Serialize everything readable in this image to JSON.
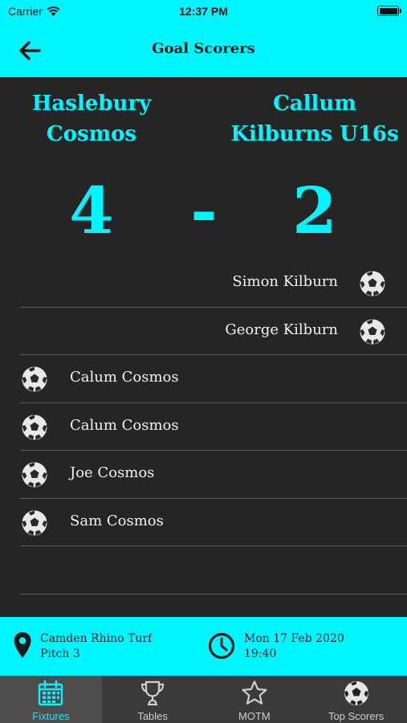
{
  "status_bar": {
    "carrier": "Carrier",
    "time": "12:37 PM"
  },
  "nav": {
    "title": "Goal Scorers"
  },
  "match": {
    "home_team": "Haslebury Cosmos",
    "away_team": "Callum Kilburns U16s",
    "home_score": "4",
    "separator": "-",
    "away_score": "2"
  },
  "scorers": [
    {
      "name": "Simon Kilburn",
      "side": "away"
    },
    {
      "name": "George Kilburn",
      "side": "away"
    },
    {
      "name": "Calum Cosmos",
      "side": "home"
    },
    {
      "name": "Calum Cosmos",
      "side": "home"
    },
    {
      "name": "Joe Cosmos",
      "side": "home"
    },
    {
      "name": "Sam Cosmos",
      "side": "home"
    }
  ],
  "info": {
    "venue": "Camden Rhino Turf",
    "pitch": "Pitch 3",
    "date": "Mon 17 Feb 2020",
    "time": "19:40"
  },
  "tabs": [
    {
      "label": "Fixtures",
      "icon": "calendar-icon",
      "active": true
    },
    {
      "label": "Tables",
      "icon": "trophy-icon",
      "active": false
    },
    {
      "label": "MOTM",
      "icon": "star-icon",
      "active": false
    },
    {
      "label": "Top Scorers",
      "icon": "football-icon",
      "active": false
    }
  ],
  "colors": {
    "accent": "#00F5FF",
    "background": "#252525",
    "tab_bar": "#3a3a3a"
  }
}
